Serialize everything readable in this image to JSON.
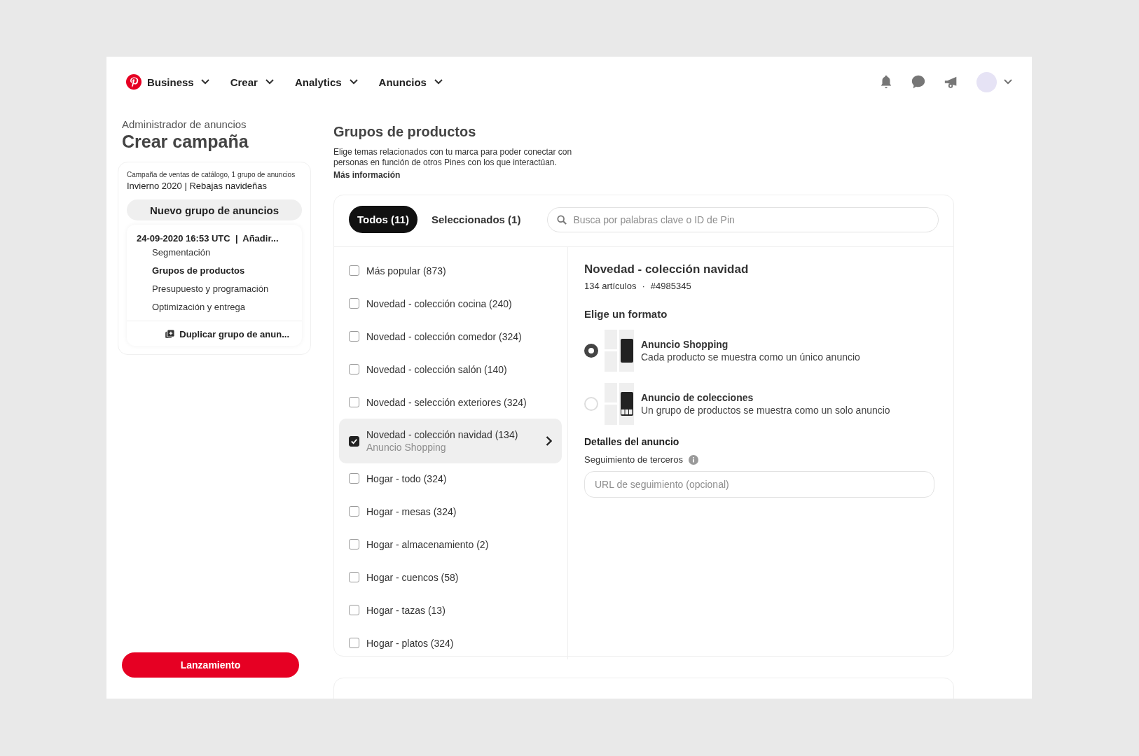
{
  "nav": {
    "items": [
      {
        "label": "Business",
        "kind": "brand"
      },
      {
        "label": "Crear",
        "kind": "menu"
      },
      {
        "label": "Analytics",
        "kind": "menu"
      },
      {
        "label": "Anuncios",
        "kind": "menu"
      }
    ]
  },
  "sidebar": {
    "breadcrumb": "Administrador de anuncios",
    "title": "Crear campaña",
    "campaign_meta": "Campaña de ventas de catálogo, 1 grupo de anuncios",
    "campaign_name": "Invierno 2020 | Rebajas navideñas",
    "new_group_button": "Nuevo grupo de anuncios",
    "group_title": "24-09-2020 16:53 UTC  |  Añadir...",
    "steps": [
      {
        "label": "Segmentación",
        "selected": false
      },
      {
        "label": "Grupos de productos",
        "selected": true
      },
      {
        "label": "Presupuesto y programación",
        "selected": false
      },
      {
        "label": "Optimización y entrega",
        "selected": false
      }
    ],
    "duplicate_button": "Duplicar grupo de anun...",
    "launch_button": "Lanzamiento"
  },
  "main": {
    "title": "Grupos de productos",
    "description": "Elige temas relacionados con tu marca para poder conectar con personas en función de otros Pines con los que interactúan.",
    "more_link": "Más información",
    "tabs": [
      {
        "label": "Todos (11)",
        "selected": true
      },
      {
        "label": "Seleccionados (1)",
        "selected": false
      }
    ],
    "search": {
      "placeholder": "Busca por palabras clave o ID de Pin"
    },
    "groups": [
      {
        "label": "Más popular (873)",
        "checked": false,
        "selected": false
      },
      {
        "label": "Novedad - colección cocina (240)",
        "checked": false,
        "selected": false
      },
      {
        "label": "Novedad - colección comedor (324)",
        "checked": false,
        "selected": false
      },
      {
        "label": "Novedad - colección salón (140)",
        "checked": false,
        "selected": false
      },
      {
        "label": "Novedad - selección exteriores (324)",
        "checked": false,
        "selected": false
      },
      {
        "label": "Novedad - colección navidad (134)",
        "sublabel": "Anuncio Shopping",
        "checked": true,
        "selected": true
      },
      {
        "label": "Hogar - todo (324)",
        "checked": false,
        "selected": false
      },
      {
        "label": "Hogar - mesas (324)",
        "checked": false,
        "selected": false
      },
      {
        "label": "Hogar - almacenamiento (2)",
        "checked": false,
        "selected": false
      },
      {
        "label": "Hogar - cuencos (58)",
        "checked": false,
        "selected": false
      },
      {
        "label": "Hogar - tazas (13)",
        "checked": false,
        "selected": false
      },
      {
        "label": "Hogar - platos (324)",
        "checked": false,
        "selected": false
      }
    ],
    "detail": {
      "title": "Novedad - colección navidad",
      "count": "134 artículos",
      "separator": "·",
      "id": "#4985345",
      "format_heading": "Elige un formato",
      "formats": [
        {
          "kind": "shopping",
          "title": "Anuncio Shopping",
          "description": "Cada producto se muestra como un único anuncio",
          "selected": true
        },
        {
          "kind": "collection",
          "title": "Anuncio de colecciones",
          "description": "Un grupo de productos se muestra como un solo anuncio",
          "selected": false
        }
      ],
      "details_heading": "Detalles del anuncio",
      "tracking_label": "Seguimiento de terceros",
      "tracking_field": {
        "placeholder": "URL de seguimiento (opcional)"
      }
    }
  }
}
